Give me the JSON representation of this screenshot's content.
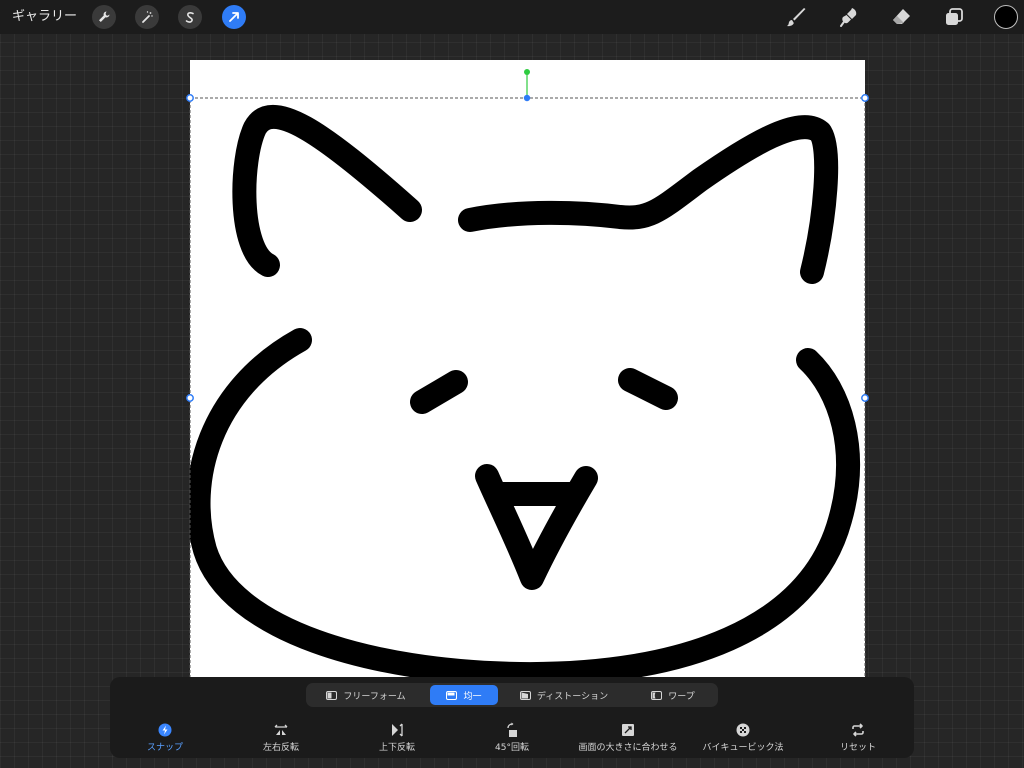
{
  "topbar": {
    "gallery_label": "ギャラリー",
    "left_tools": [
      {
        "name": "wrench-icon",
        "active": false
      },
      {
        "name": "magic-wand-icon",
        "active": false
      },
      {
        "name": "selection-s-icon",
        "active": false
      },
      {
        "name": "transform-arrow-icon",
        "active": true
      }
    ],
    "right_tools": [
      "brush-icon",
      "smudge-icon",
      "eraser-icon",
      "layers-icon"
    ],
    "current_color": "#000000"
  },
  "transform_modes": [
    {
      "label": "フリーフォーム",
      "icon": "freeform-icon",
      "active": false
    },
    {
      "label": "均一",
      "icon": "uniform-icon",
      "active": true
    },
    {
      "label": "ディストーション",
      "icon": "distort-icon",
      "active": false
    },
    {
      "label": "ワープ",
      "icon": "warp-icon",
      "active": false
    }
  ],
  "actions": [
    {
      "label": "スナップ",
      "icon": "snap-icon",
      "active": true
    },
    {
      "label": "左右反転",
      "icon": "flip-horizontal-icon",
      "active": false
    },
    {
      "label": "上下反転",
      "icon": "flip-vertical-icon",
      "active": false
    },
    {
      "label": "45°回転",
      "icon": "rotate-45-icon",
      "active": false
    },
    {
      "label": "画面の大きさに合わせる",
      "icon": "fit-to-screen-icon",
      "active": false
    },
    {
      "label": "バイキュービック法",
      "icon": "bicubic-icon",
      "active": false
    },
    {
      "label": "リセット",
      "icon": "reset-icon",
      "active": false
    }
  ],
  "colors": {
    "accent": "#2f7cf6",
    "rotation_handle": "#2ecc40",
    "canvas": "#ffffff",
    "stroke": "#000000"
  }
}
